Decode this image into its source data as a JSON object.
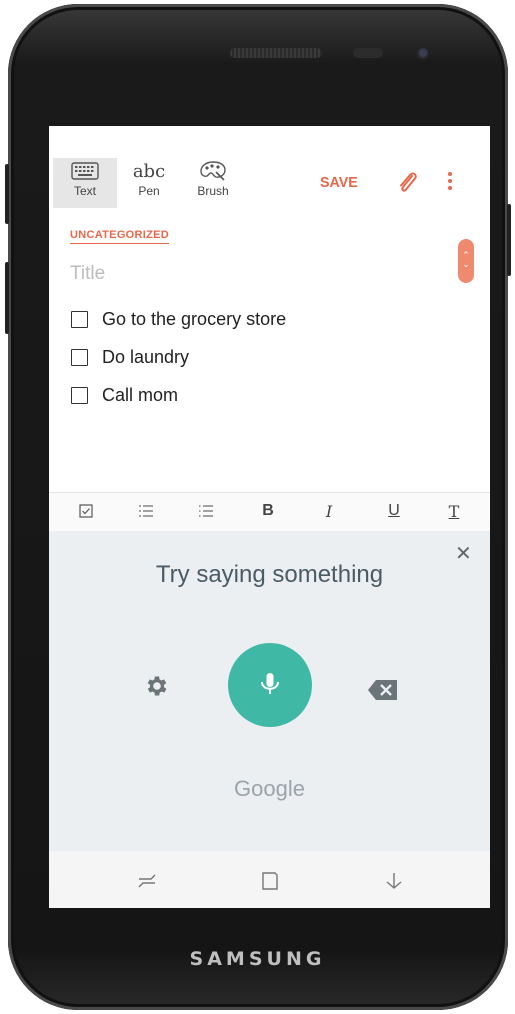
{
  "device": {
    "brand": "SAMSUNG"
  },
  "toolbar": {
    "tools": [
      {
        "label": "Text",
        "icon": "keyboard-icon",
        "active": true
      },
      {
        "label": "Pen",
        "glyph": "abc",
        "icon": "handwriting-icon"
      },
      {
        "label": "Brush",
        "icon": "palette-icon"
      }
    ],
    "save_label": "SAVE",
    "attach_icon": "paperclip-icon",
    "more_icon": "more-vertical-icon"
  },
  "note": {
    "category": "UNCATEGORIZED",
    "title_placeholder": "Title",
    "items": [
      {
        "text": "Go to the grocery store",
        "checked": false
      },
      {
        "text": "Do laundry",
        "checked": false
      },
      {
        "text": "Call mom",
        "checked": false
      }
    ]
  },
  "format_bar": {
    "items": [
      {
        "icon": "checkbox-icon"
      },
      {
        "icon": "numbered-list-icon"
      },
      {
        "icon": "bullet-list-icon"
      },
      {
        "label": "B",
        "icon": "bold-icon"
      },
      {
        "label": "I",
        "icon": "italic-icon"
      },
      {
        "label": "U",
        "icon": "underline-icon"
      },
      {
        "label": "T",
        "icon": "text-style-icon"
      }
    ]
  },
  "voice": {
    "prompt": "Try saying something",
    "brand": "Google",
    "mic_color": "#3fb9a5"
  },
  "navbar": {
    "items": [
      "recent-apps-icon",
      "home-icon",
      "back-icon"
    ]
  },
  "colors": {
    "accent": "#e8674b"
  }
}
